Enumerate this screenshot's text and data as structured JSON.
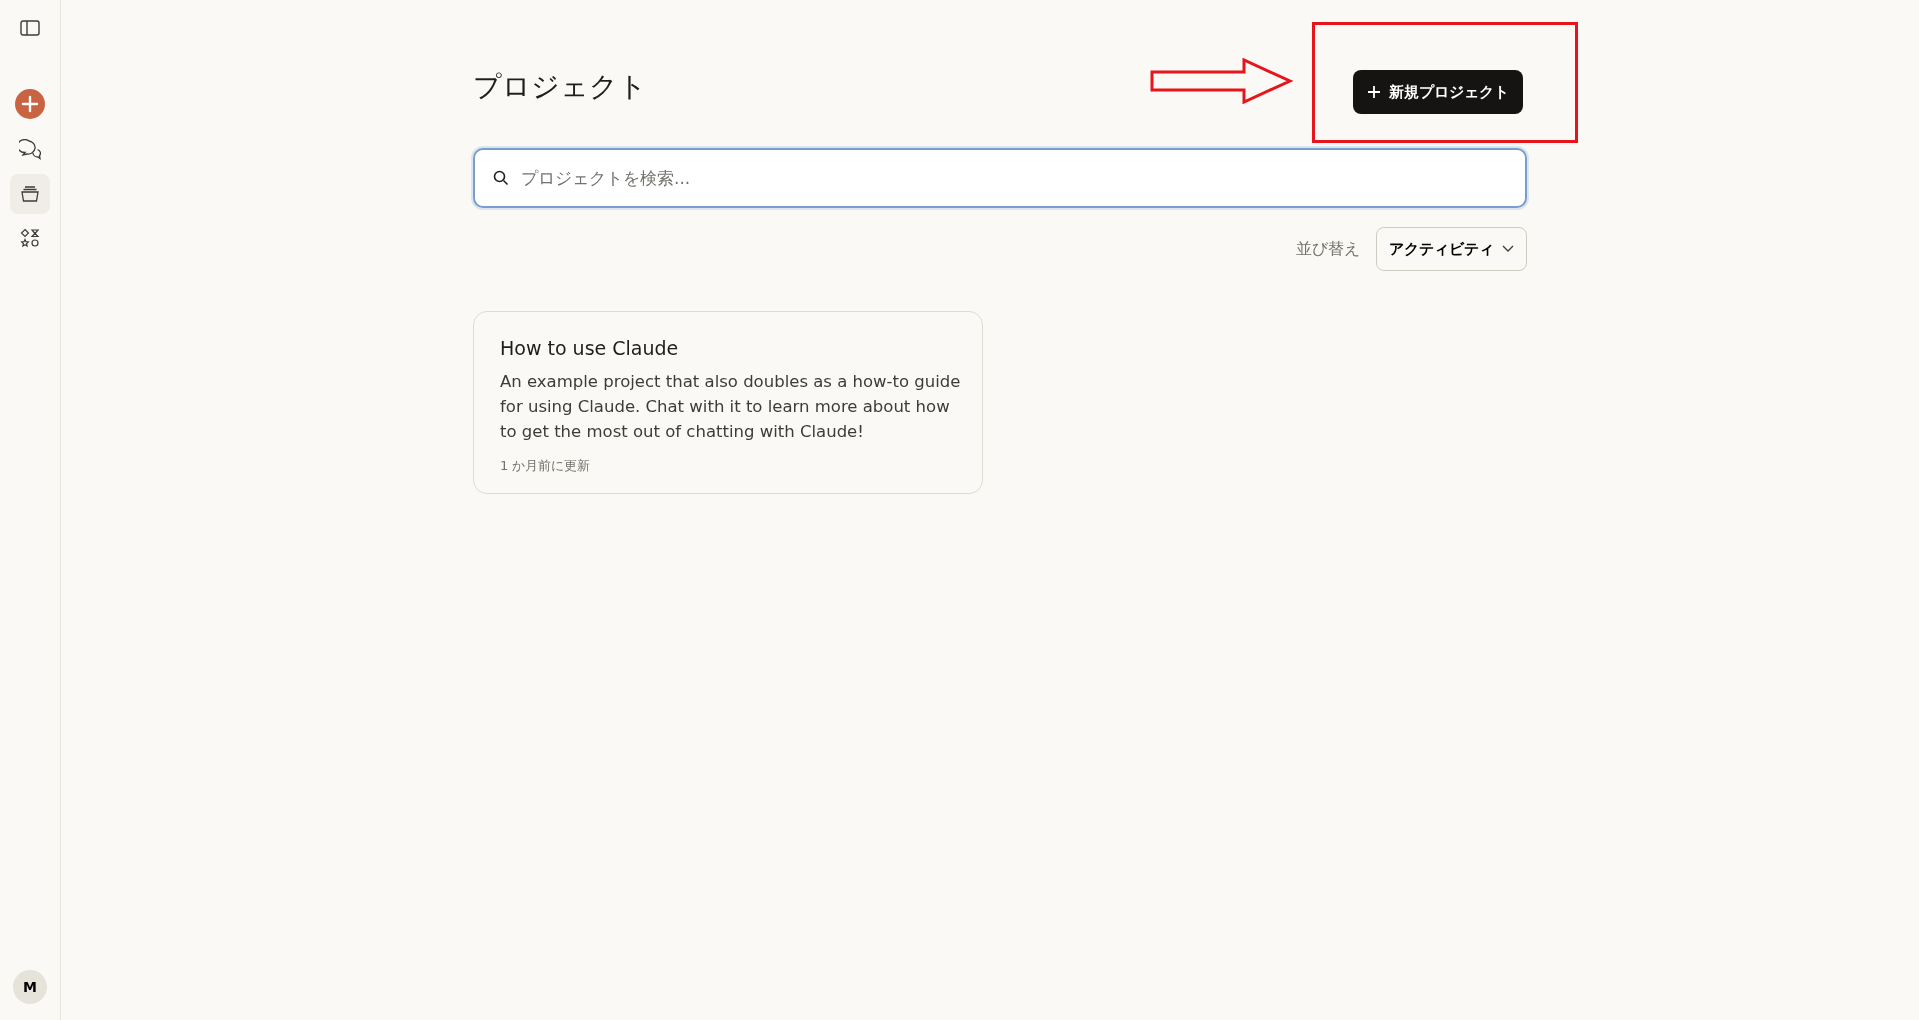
{
  "sidebar": {
    "items": [
      {
        "kind": "toggle",
        "selected": false
      },
      {
        "kind": "new",
        "selected": false
      },
      {
        "kind": "chats",
        "selected": false
      },
      {
        "kind": "projects",
        "selected": true
      },
      {
        "kind": "artifacts",
        "selected": false
      }
    ],
    "avatar": "M"
  },
  "header": {
    "title": "プロジェクト",
    "new_button": "新規プロジェクト"
  },
  "search": {
    "placeholder": "プロジェクトを検索..."
  },
  "sort": {
    "label": "並び替え",
    "value": "アクティビティ"
  },
  "projects": [
    {
      "title": "How to use Claude",
      "description": "An example project that also doubles as a how-to guide for using Claude. Chat with it to learn more about how to get the most out of chatting with Claude!",
      "updated": "1 か月前に更新"
    }
  ],
  "annotations": [
    {
      "kind": "arrow"
    },
    {
      "kind": "frame"
    }
  ]
}
